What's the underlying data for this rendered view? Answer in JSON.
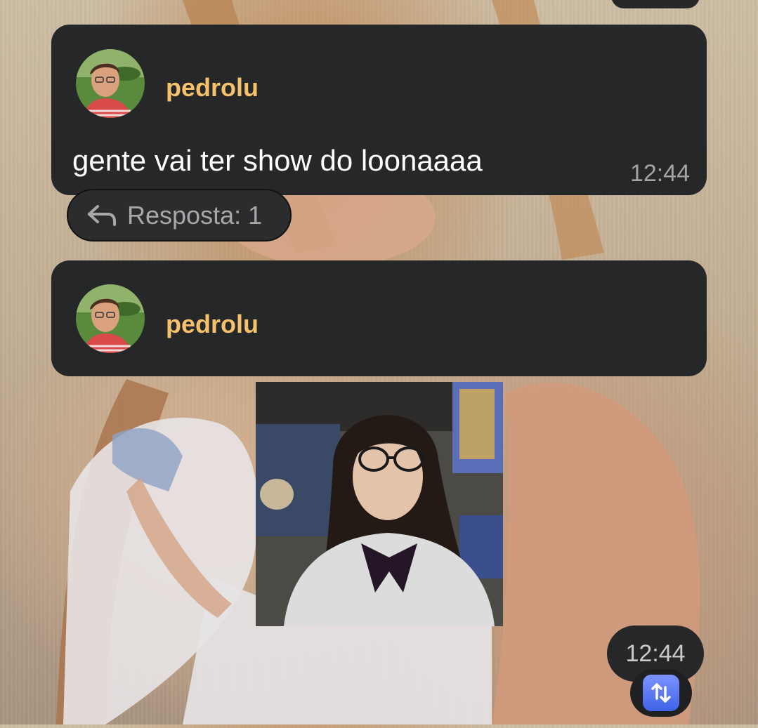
{
  "messages": [
    {
      "author": "pedrolu",
      "text": "gente vai ter show do loonaaaa",
      "time": "12:44",
      "reply_label": "Resposta: 1"
    },
    {
      "author": "pedrolu",
      "time": "12:44"
    }
  ],
  "icons": {
    "reply": "reply-arrow-icon",
    "forward": "repeat-icon"
  },
  "colors": {
    "bubble": "#262728",
    "author": "#f5c26b",
    "text": "#ffffff",
    "time": "#a2a4a6",
    "forward_button": "#4a6cf0"
  }
}
